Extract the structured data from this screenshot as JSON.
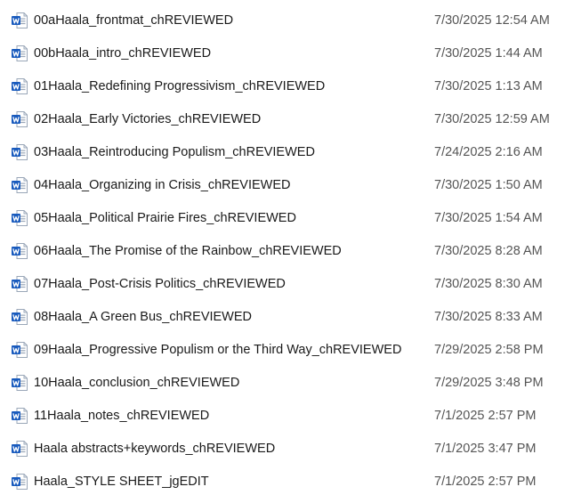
{
  "files": [
    {
      "name": "00aHaala_frontmat_chREVIEWED",
      "modified": "7/30/2025 12:54 AM",
      "icon": "word-document-icon"
    },
    {
      "name": "00bHaala_intro_chREVIEWED",
      "modified": "7/30/2025 1:44 AM",
      "icon": "word-document-icon"
    },
    {
      "name": "01Haala_Redefining Progressivism_chREVIEWED",
      "modified": "7/30/2025 1:13 AM",
      "icon": "word-document-icon"
    },
    {
      "name": "02Haala_Early Victories_chREVIEWED",
      "modified": "7/30/2025 12:59 AM",
      "icon": "word-document-icon"
    },
    {
      "name": "03Haala_Reintroducing Populism_chREVIEWED",
      "modified": "7/24/2025 2:16 AM",
      "icon": "word-document-icon"
    },
    {
      "name": "04Haala_Organizing in Crisis_chREVIEWED",
      "modified": "7/30/2025 1:50 AM",
      "icon": "word-document-icon"
    },
    {
      "name": "05Haala_Political Prairie Fires_chREVIEWED",
      "modified": "7/30/2025 1:54 AM",
      "icon": "word-document-icon"
    },
    {
      "name": "06Haala_The Promise of the Rainbow_chREVIEWED",
      "modified": "7/30/2025 8:28 AM",
      "icon": "word-document-icon"
    },
    {
      "name": "07Haala_Post-Crisis Politics_chREVIEWED",
      "modified": "7/30/2025 8:30 AM",
      "icon": "word-document-icon"
    },
    {
      "name": "08Haala_A Green Bus_chREVIEWED",
      "modified": "7/30/2025 8:33 AM",
      "icon": "word-document-icon"
    },
    {
      "name": "09Haala_Progressive Populism or the Third Way_chREVIEWED",
      "modified": "7/29/2025 2:58 PM",
      "icon": "word-document-icon"
    },
    {
      "name": "10Haala_conclusion_chREVIEWED",
      "modified": "7/29/2025 3:48 PM",
      "icon": "word-document-icon"
    },
    {
      "name": "11Haala_notes_chREVIEWED",
      "modified": "7/1/2025 2:57 PM",
      "icon": "word-document-icon"
    },
    {
      "name": "Haala abstracts+keywords_chREVIEWED",
      "modified": "7/1/2025 3:47 PM",
      "icon": "word-document-icon"
    },
    {
      "name": "Haala_STYLE SHEET_jgEDIT",
      "modified": "7/1/2025 2:57 PM",
      "icon": "word-document-icon"
    }
  ],
  "colors": {
    "word_blue": "#185abd",
    "word_blue_dark": "#103f91",
    "page_white": "#ffffff",
    "page_border": "#9aa7b8",
    "date_text": "#555555"
  }
}
